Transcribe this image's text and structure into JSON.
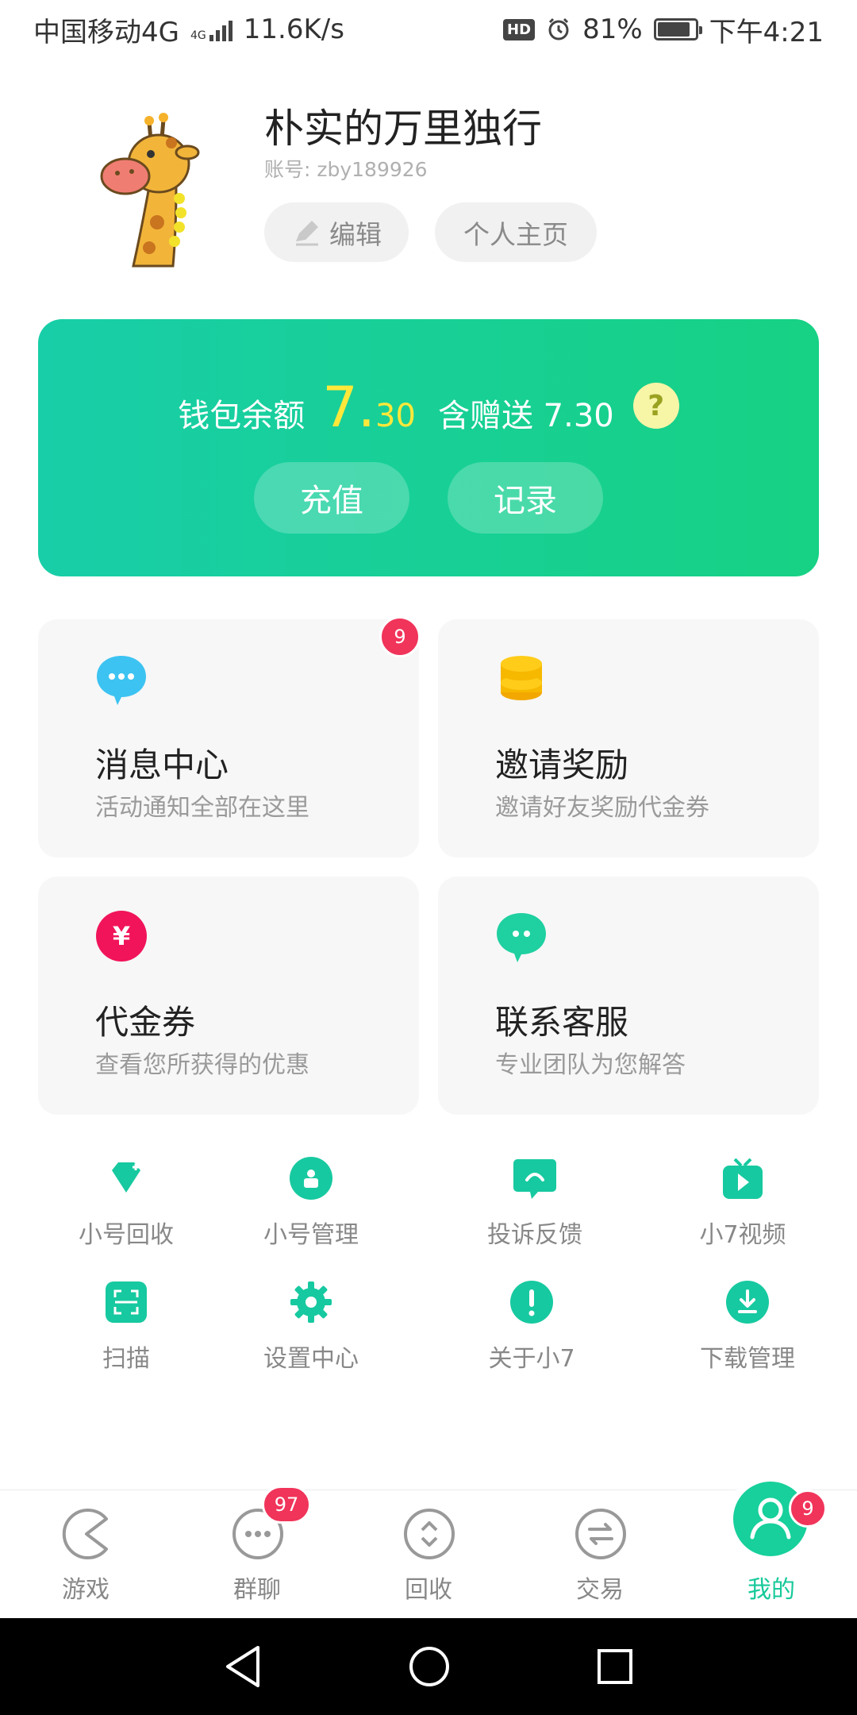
{
  "status_bar": {
    "carrier": "中国移动4G",
    "net_type": "4G",
    "speed": "11.6K/s",
    "hd": "HD",
    "battery": "81%",
    "battery_level": 0.81,
    "time": "下午4:21"
  },
  "profile": {
    "name": "朴实的万里独行",
    "account": "账号: zby189926",
    "edit_label": "编辑",
    "homepage_label": "个人主页"
  },
  "wallet": {
    "label": "钱包余额",
    "balance_int": "7.",
    "balance_dec": "30",
    "gift_text": "含赠送 7.30",
    "help": "?",
    "recharge_label": "充值",
    "record_label": "记录"
  },
  "cards": [
    {
      "icon": "chat-bubble-icon",
      "title": "消息中心",
      "subtitle": "活动通知全部在这里",
      "badge": "9"
    },
    {
      "icon": "coins-icon",
      "title": "邀请奖励",
      "subtitle": "邀请好友奖励代金券"
    },
    {
      "icon": "yen-coupon-icon",
      "title": "代金券",
      "subtitle": "查看您所获得的优惠"
    },
    {
      "icon": "customer-service-icon",
      "title": "联系客服",
      "subtitle": "专业团队为您解答"
    }
  ],
  "grid": [
    {
      "icon": "diamond-icon",
      "label": "小号回收"
    },
    {
      "icon": "account-manage-icon",
      "label": "小号管理"
    },
    {
      "icon": "feedback-icon",
      "label": "投诉反馈"
    },
    {
      "icon": "video-tv-icon",
      "label": "小7视频"
    },
    {
      "icon": "scan-icon",
      "label": "扫描"
    },
    {
      "icon": "gear-icon",
      "label": "设置中心"
    },
    {
      "icon": "exclamation-icon",
      "label": "关于小7"
    },
    {
      "icon": "download-icon",
      "label": "下载管理"
    }
  ],
  "nav": [
    {
      "icon": "pacman-icon",
      "label": "游戏"
    },
    {
      "icon": "group-chat-icon",
      "label": "群聊",
      "badge": "97"
    },
    {
      "icon": "recycle-icon",
      "label": "回收"
    },
    {
      "icon": "trade-icon",
      "label": "交易"
    },
    {
      "icon": "profile-icon",
      "label": "我的",
      "badge": "9",
      "active": true
    }
  ],
  "colors": {
    "accent": "#17d09b",
    "badge": "#f1345a",
    "balance": "#ffe83a"
  }
}
